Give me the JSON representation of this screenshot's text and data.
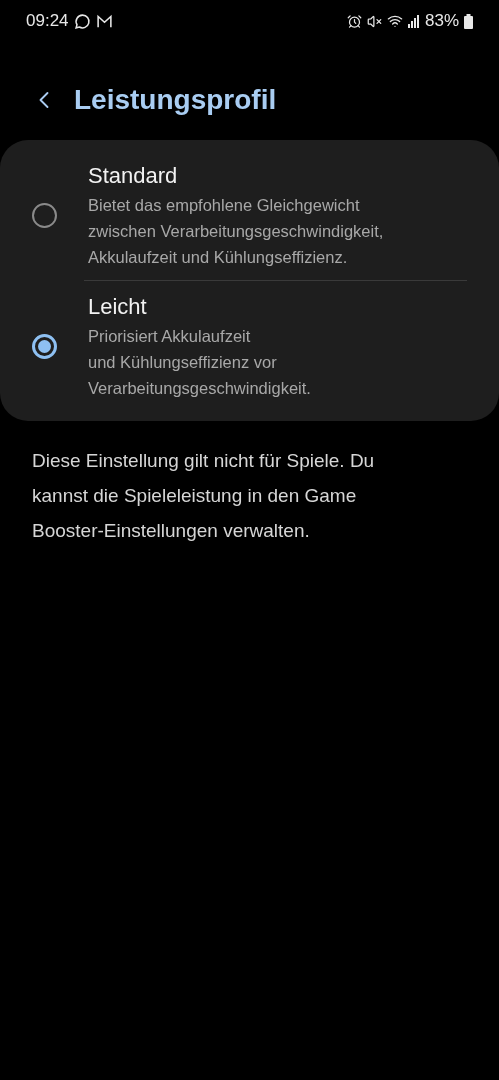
{
  "status_bar": {
    "time": "09:24",
    "battery": "83%"
  },
  "header": {
    "title": "Leistungsprofil"
  },
  "options": [
    {
      "title": "Standard",
      "description": "Bietet das empfohlene Gleichgewicht\nzwischen Verarbeitungsgeschwindigkeit,\nAkkulaufzeit und Kühlungseffizienz.",
      "selected": false
    },
    {
      "title": "Leicht",
      "description": "Priorisiert Akkulaufzeit\nund Kühlungseffizienz vor\nVerarbeitungsgeschwindigkeit.",
      "selected": true
    }
  ],
  "note": "Diese Einstellung gilt nicht für Spiele. Du kannst die Spieleleistung in den Game Booster-Einstellungen verwalten."
}
